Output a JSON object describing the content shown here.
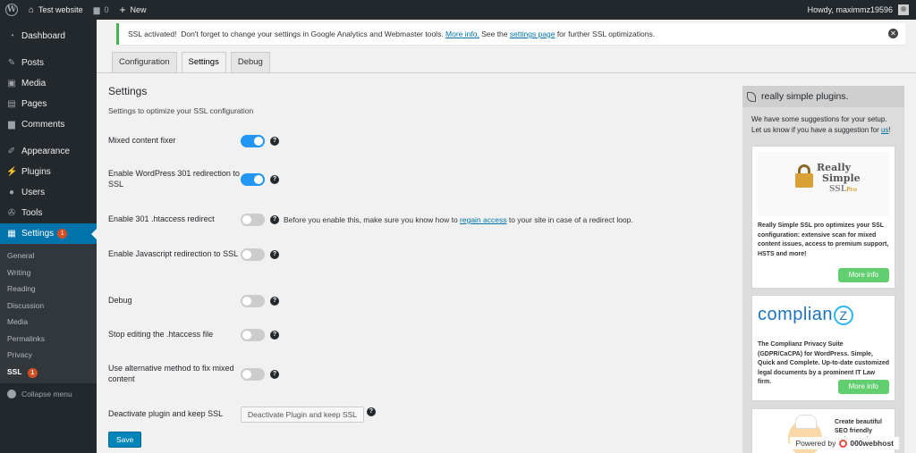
{
  "adminbar": {
    "site_name": "Test website",
    "comments_count": "0",
    "new_label": "New",
    "greeting": "Howdy, maximmz19596"
  },
  "sidebar": {
    "items": [
      {
        "label": "Dashboard",
        "icon": "dashboard-icon"
      },
      {
        "label": "Posts",
        "icon": "pin-icon"
      },
      {
        "label": "Media",
        "icon": "media-icon"
      },
      {
        "label": "Pages",
        "icon": "pages-icon"
      },
      {
        "label": "Comments",
        "icon": "comment-icon"
      },
      {
        "label": "Appearance",
        "icon": "brush-icon"
      },
      {
        "label": "Plugins",
        "icon": "plugin-icon"
      },
      {
        "label": "Users",
        "icon": "user-icon"
      },
      {
        "label": "Tools",
        "icon": "wrench-icon"
      },
      {
        "label": "Settings",
        "icon": "settings-icon",
        "badge": "1"
      }
    ],
    "submenu": [
      "General",
      "Writing",
      "Reading",
      "Discussion",
      "Media",
      "Permalinks",
      "Privacy",
      "SSL"
    ],
    "ssl_badge": "1",
    "collapse_label": "Collapse menu"
  },
  "notice": {
    "text_before": "SSL activated!  Don't forget to change your settings in Google Analytics and Webmaster tools. ",
    "link1": "More info.",
    "text_mid": " See the ",
    "link2": "settings page",
    "text_after": " for further SSL optimizations."
  },
  "tabs": [
    "Configuration",
    "Settings",
    "Debug"
  ],
  "settings": {
    "title": "Settings",
    "description": "Settings to optimize your SSL configuration",
    "rows": [
      {
        "label": "Mixed content fixer",
        "on": true
      },
      {
        "label": "Enable WordPress 301 redirection to SSL",
        "on": true
      },
      {
        "label": "Enable 301 .htaccess redirect",
        "on": false
      },
      {
        "label": "Enable Javascript redirection to SSL",
        "on": false
      },
      {
        "label": "Debug",
        "on": false
      },
      {
        "label": "Stop editing the .htaccess file",
        "on": false
      },
      {
        "label": "Use alternative method to fix mixed content",
        "on": false
      }
    ],
    "htaccess_hint_before": "Before you enable this, make sure you know how to ",
    "htaccess_hint_link": "regain access",
    "htaccess_hint_after": " to your site in case of a redirect loop.",
    "deactivate_label": "Deactivate plugin and keep SSL",
    "deactivate_button": "Deactivate Plugin and keep SSL",
    "save_button": "Save",
    "help_glyph": "?"
  },
  "promo": {
    "title": "really simple plugins.",
    "intro_line1": "We have some suggestions for your setup.",
    "intro_line2_before": "Let us know if you have a suggestion for ",
    "intro_link": "us",
    "intro_line2_after": "!",
    "card1": {
      "logo_line1": "Really",
      "logo_line2": "Simple",
      "logo_line3": "SSL",
      "logo_pro": "Pro",
      "text": "Really Simple SSL pro optimizes your SSL configuration: extensive scan for mixed content issues, access to premium support, HSTS and more!",
      "button": "More info"
    },
    "card2": {
      "logo": "complian",
      "logo_mark": "Z",
      "text": "The Complianz Privacy Suite (GDPR/CaCPA) for WordPress. Simple, Quick and Complete. Up-to-date customized legal documents by a prominent IT Law firm.",
      "button": "More info"
    },
    "card3": {
      "text": "Create beautiful SEO friendly recipe cards"
    },
    "powered_label": "Powered by",
    "powered_brand": "000webhost"
  },
  "colors": {
    "admin_dark": "#23282d",
    "active_blue": "#0073aa",
    "toggle_on": "#2196f3",
    "notice_green": "#46b450",
    "more_info_green": "#61ce70",
    "badge_orange": "#d54e21"
  }
}
